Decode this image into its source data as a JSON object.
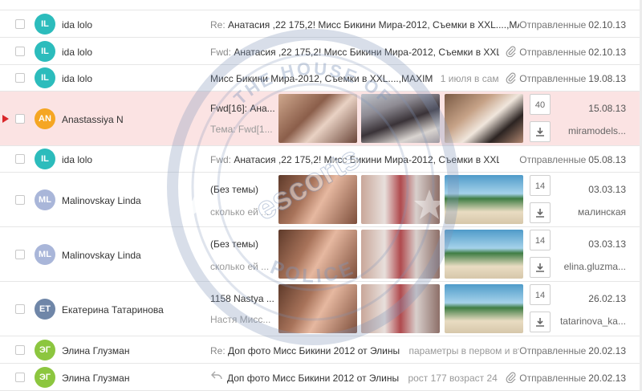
{
  "simple_rows": [
    {
      "initials": "IL",
      "color": "#2cbcbc",
      "sender": "ida lolo",
      "prefix": "Re:",
      "subject": "Анатасия ,22 175,2! Мисс Бикини Мира-2012, Съемки в XXL....,MAX...",
      "snippet": "",
      "attachment": false,
      "folder": "Отправленные",
      "date": "02.10.13"
    },
    {
      "initials": "IL",
      "color": "#2cbcbc",
      "sender": "ida lolo",
      "prefix": "Fwd:",
      "subject": "Анатасия ,22 175,2! Мисс Бикини Мира-2012, Съемки в XXL....",
      "snippet": "",
      "attachment": true,
      "folder": "Отправленные",
      "date": "02.10.13"
    },
    {
      "initials": "IL",
      "color": "#2cbcbc",
      "sender": "ida lolo",
      "prefix": "",
      "subject": "Мисс Бикини Мира-2012, Съемки в XXL....,MAXIM",
      "snippet": "1 июля в само...",
      "attachment": true,
      "folder": "Отправленные",
      "date": "19.08.13"
    },
    {
      "initials": "IL",
      "color": "#2cbcbc",
      "sender": "ida lolo",
      "prefix": "Fwd:",
      "subject": "Анатасия ,22 175,2! Мисс Бикини Мира-2012, Съемки в XXL....",
      "snippet": "",
      "attachment": false,
      "folder": "Отправленные",
      "date": "05.08.13"
    },
    {
      "initials": "ЭГ",
      "color": "#8cc63f",
      "sender": "Элина Глузман",
      "prefix": "Re:",
      "subject": "Доп фото Мисс Бикини 2012 от Элины",
      "snippet": "параметры в первом и втор...",
      "attachment": false,
      "folder": "Отправленные",
      "date": "20.02.13"
    },
    {
      "initials": "ЭГ",
      "color": "#8cc63f",
      "sender": "Элина Глузман",
      "prefix": "",
      "subject": "Доп фото Мисс Бикини 2012 от Элины",
      "snippet": "рост 177 возраст 24 во...",
      "attachment": true,
      "reply": true,
      "folder": "Отправленные",
      "date": "20.02.13"
    }
  ],
  "big_rows": [
    {
      "initials": "AN",
      "color": "#f5a623",
      "sender": "Anastassiya N",
      "subject": "Fwd[16]: Ана...",
      "snippet": "Тема: Fwd[1...",
      "count": "40",
      "date": "15.08.13",
      "from": "miramodels...",
      "highlight": true
    },
    {
      "initials": "ML",
      "color": "#a9b6d9",
      "sender": "Malinovskay Linda",
      "subject": "(Без темы)",
      "snippet": "сколько ей ...",
      "count": "14",
      "date": "03.03.13",
      "from": "малинская",
      "highlight": false
    },
    {
      "initials": "ML",
      "color": "#a9b6d9",
      "sender": "Malinovskay Linda",
      "subject": "(Без темы)",
      "snippet": "сколько ей ...",
      "count": "14",
      "date": "03.03.13",
      "from": "elina.gluzma...",
      "highlight": false
    },
    {
      "initials": "ET",
      "color": "#6f86a8",
      "sender": "Екатерина Татаринова",
      "subject": "1158 Nastya ...",
      "snippet": "Настя Мисс...",
      "count": "14",
      "date": "26.02.13",
      "from": "tatarinova_ka...",
      "highlight": false
    }
  ],
  "watermark": {
    "top_text": "THE HOUSE OF",
    "middle_text": "escorts",
    "bottom_text": "POLICE"
  },
  "icons": {
    "checkbox": "checkbox-icon",
    "attachment": "paperclip-icon",
    "download": "download-icon",
    "reply": "reply-arrow-icon",
    "flag": "flag-icon"
  },
  "colors": {
    "highlight_row": "#fbe3e3",
    "flag": "#d9262a",
    "border": "#e6e6e6"
  }
}
